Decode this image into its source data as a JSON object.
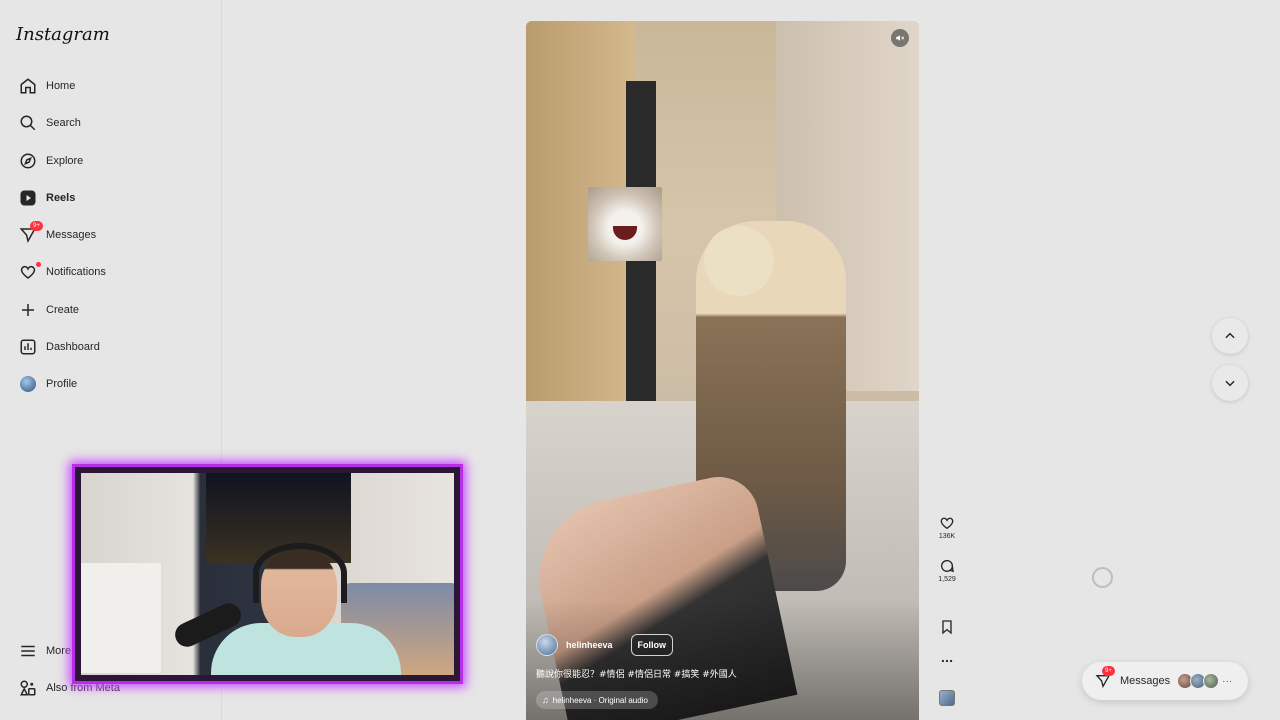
{
  "app": {
    "logo": "Instagram"
  },
  "sidebar": {
    "items": [
      {
        "label": "Home",
        "icon": "home-icon"
      },
      {
        "label": "Search",
        "icon": "search-icon"
      },
      {
        "label": "Explore",
        "icon": "compass-icon"
      },
      {
        "label": "Reels",
        "icon": "reels-icon",
        "active": true
      },
      {
        "label": "Messages",
        "icon": "messenger-icon",
        "badge": "9+"
      },
      {
        "label": "Notifications",
        "icon": "heart-icon",
        "dot": true
      },
      {
        "label": "Create",
        "icon": "plus-icon"
      },
      {
        "label": "Dashboard",
        "icon": "dashboard-icon"
      },
      {
        "label": "Profile",
        "icon": "avatar"
      }
    ],
    "footer": [
      {
        "label": "More",
        "icon": "menu-icon"
      },
      {
        "label": "Also from Meta",
        "icon": "meta-apps-icon"
      }
    ]
  },
  "reel": {
    "author": "helinheeva",
    "follow_label": "Follow",
    "caption": "聽說你很能忍？#情侶 #情侶日常 #搞笑 #外國人",
    "audio": "helinheeva · Original audio",
    "muted": true
  },
  "actions": {
    "likes": "136K",
    "comments": "1,529"
  },
  "messages_pill": {
    "label": "Messages",
    "badge": "9+",
    "more": "···"
  },
  "colors": {
    "badge": "#ff3040",
    "webcam_border": "#b62ee6",
    "background": "#e6e6e6"
  }
}
